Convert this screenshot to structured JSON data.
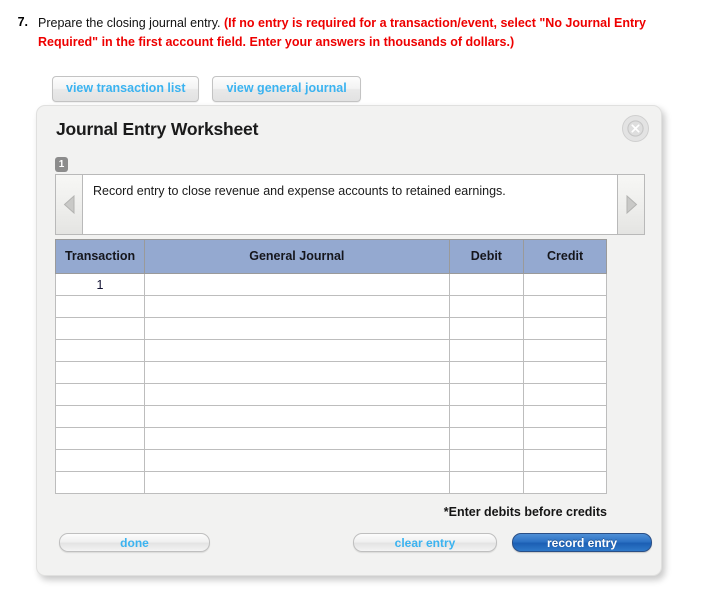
{
  "question": {
    "number": "7.",
    "plain_text": "Prepare the closing journal entry.",
    "red_text": "(If no entry is required for a transaction/event, select \"No Journal Entry Required\" in the first account field. Enter your answers in thousands of dollars.)",
    "red_color": "#ee0000"
  },
  "tabs": [
    {
      "label": "view transaction list",
      "name": "view-transaction-list"
    },
    {
      "label": "view general journal",
      "name": "view-general-journal"
    }
  ],
  "worksheet": {
    "title": "Journal Entry Worksheet",
    "close_icon": "close-icon",
    "step_badge": "1",
    "prev_icon": "chevron-left-icon",
    "next_icon": "chevron-right-icon",
    "instruction": "Record entry to close revenue and expense accounts to retained earnings.",
    "table": {
      "headers": [
        "Transaction",
        "General Journal",
        "Debit",
        "Credit"
      ],
      "rows": [
        {
          "transaction": "1",
          "general_journal": "",
          "debit": "",
          "credit": ""
        },
        {
          "transaction": "",
          "general_journal": "",
          "debit": "",
          "credit": ""
        },
        {
          "transaction": "",
          "general_journal": "",
          "debit": "",
          "credit": ""
        },
        {
          "transaction": "",
          "general_journal": "",
          "debit": "",
          "credit": ""
        },
        {
          "transaction": "",
          "general_journal": "",
          "debit": "",
          "credit": ""
        },
        {
          "transaction": "",
          "general_journal": "",
          "debit": "",
          "credit": ""
        },
        {
          "transaction": "",
          "general_journal": "",
          "debit": "",
          "credit": ""
        },
        {
          "transaction": "",
          "general_journal": "",
          "debit": "",
          "credit": ""
        },
        {
          "transaction": "",
          "general_journal": "",
          "debit": "",
          "credit": ""
        },
        {
          "transaction": "",
          "general_journal": "",
          "debit": "",
          "credit": ""
        }
      ],
      "header_color": "#94a9d0",
      "input_border_color": "#f5f12a"
    },
    "footnote": "*Enter debits before credits",
    "buttons": {
      "done": "done",
      "clear_entry": "clear entry",
      "record_entry": "record entry"
    },
    "accent_color": "#3bb3f0",
    "primary_color": "#2d72c4"
  }
}
